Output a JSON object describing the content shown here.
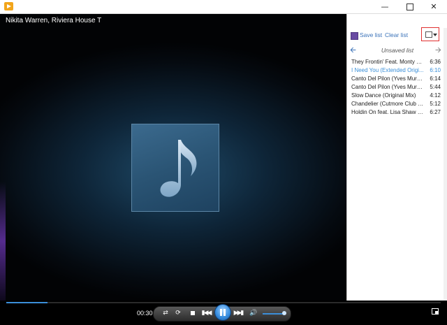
{
  "window": {
    "minimize_glyph": "—",
    "close_glyph": "✕"
  },
  "now_playing": {
    "title": "Nikita Warren, Riviera House T"
  },
  "playlist": {
    "save_label": "Save list",
    "clear_label": "Clear list",
    "list_title": "Unsaved list",
    "tracks": [
      {
        "title": "They Frontin' Feat. Monty Lu...",
        "duration": "6:36",
        "active": false
      },
      {
        "title": "I Need You (Extended Origi...",
        "duration": "6:10",
        "active": true
      },
      {
        "title": "Canto Del Pilon (Yves Mura...",
        "duration": "6:14",
        "active": false
      },
      {
        "title": "Canto Del Pilon (Yves Mura...",
        "duration": "5:44",
        "active": false
      },
      {
        "title": "Slow Dance (Original Mix)",
        "duration": "4:12",
        "active": false
      },
      {
        "title": "Chandelier (Cutmore Club R...",
        "duration": "5:12",
        "active": false
      },
      {
        "title": "Holdin On feat. Lisa Shaw (...",
        "duration": "6:27",
        "active": false
      }
    ]
  },
  "controls": {
    "time": "00:30",
    "progress_fraction": 0.095,
    "volume_fraction": 0.9
  },
  "colors": {
    "accent": "#3a8fd8",
    "link": "#3a72b8",
    "highlight_box": "#e03030"
  },
  "icons": [
    "media-player-app-icon",
    "music-note-icon",
    "save-icon",
    "view-options-icon",
    "back-arrow-icon",
    "forward-arrow-icon",
    "shuffle-icon",
    "repeat-icon",
    "stop-icon",
    "previous-icon",
    "pause-icon",
    "next-icon",
    "volume-icon",
    "fullscreen-icon"
  ]
}
